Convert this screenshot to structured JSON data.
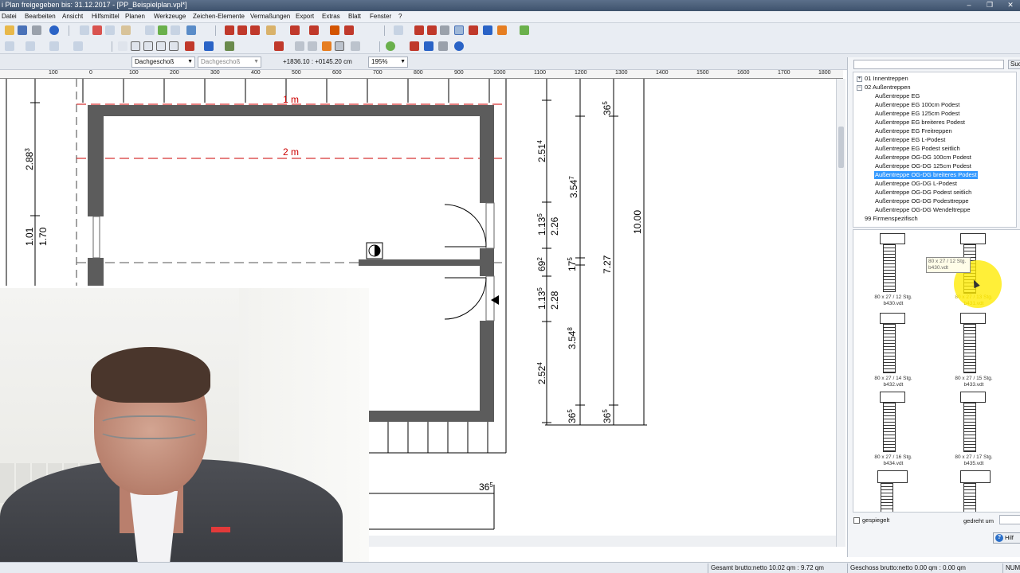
{
  "window": {
    "title": "i Plan freigegeben bis: 31.12.2017 - [PP_Beispielplan.vpl*]",
    "controls": [
      "–",
      "❐",
      "✕"
    ]
  },
  "menu": [
    "Datei",
    "Bearbeiten",
    "Ansicht",
    "Hilfsmittel",
    "Planen",
    "Werkzeuge",
    "Zeichen-Elemente",
    "Vermaßungen",
    "Export",
    "Extras",
    "Blatt",
    "Fenster",
    "?"
  ],
  "optionsbar": {
    "floor_select": "Dachgeschoß",
    "floor_select2": "Dachgeschoß",
    "coords": "+1836.10 : +0145.20 cm",
    "zoom": "195%"
  },
  "ruler": {
    "labels": [
      "100",
      "0",
      "100",
      "200",
      "300",
      "400",
      "500",
      "600",
      "700",
      "800",
      "900",
      "1000",
      "1100",
      "1200",
      "1300",
      "1400",
      "1500",
      "1600",
      "1700",
      "1800"
    ]
  },
  "drawing": {
    "dim_1m": "1 m",
    "dim_2m": "2 m",
    "dims_left": {
      "d288": "2.88",
      "d288_sup": "3",
      "d101": "1.01",
      "d170": "1.70"
    },
    "dims_right1": {
      "a": "2.51",
      "a_sup": "4",
      "b": "1.13",
      "b_sup": "5",
      "c": "69",
      "c_sup": "2",
      "d": "1.13",
      "d_sup": "5",
      "e": "2.52",
      "e_sup": "4"
    },
    "dims_right2": {
      "a": "3.54",
      "a_sup": "7",
      "b": "2.26",
      "c": "17",
      "c_sup": "5",
      "d": "2.28",
      "e": "3.54",
      "e_sup": "8",
      "f": "36",
      "f_sup": "5"
    },
    "dims_right3": {
      "a": "36",
      "a_sup": "5",
      "b": "7.27",
      "c": "36",
      "c_sup": "5"
    },
    "dims_right4": {
      "a": "10.00"
    },
    "dim_bottom": {
      "a": "36",
      "a_sup": "5"
    }
  },
  "library": {
    "search_button": "Such",
    "tree": [
      {
        "label": "01 Innentreppen",
        "level": 0,
        "expander": "+"
      },
      {
        "label": "02 Außentreppen",
        "level": 0,
        "expander": "−"
      },
      {
        "label": "Außentreppe EG",
        "level": 1
      },
      {
        "label": "Außentreppe EG 100cm Podest",
        "level": 1
      },
      {
        "label": "Außentreppe EG 125cm Podest",
        "level": 1
      },
      {
        "label": "Außentreppe EG breiteres Podest",
        "level": 1
      },
      {
        "label": "Außentreppe EG Freitreppen",
        "level": 1
      },
      {
        "label": "Außentreppe EG L-Podest",
        "level": 1
      },
      {
        "label": "Außentreppe EG Podest seitlich",
        "level": 1
      },
      {
        "label": "Außentreppe OG-DG 100cm Podest",
        "level": 1
      },
      {
        "label": "Außentreppe OG-DG 125cm Podest",
        "level": 1
      },
      {
        "label": "Außentreppe OG-DG breiteres Podest",
        "level": 1,
        "selected": true
      },
      {
        "label": "Außentreppe OG-DG L-Podest",
        "level": 1
      },
      {
        "label": "Außentreppe OG-DG Podest seitlich",
        "level": 1
      },
      {
        "label": "Außentreppe OG-DG Podesttreppe",
        "level": 1
      },
      {
        "label": "Außentreppe OG-DG Wendeltreppe",
        "level": 1
      },
      {
        "label": "99 Firmenspezifisch",
        "level": 0
      }
    ],
    "thumbnails": [
      {
        "caption": "80 x 27 / 12 Stg.",
        "file": "b430.vdt",
        "steps": 12
      },
      {
        "caption": "80 x 27 / 13 Stg.",
        "file": "b431.vdt",
        "steps": 13
      },
      {
        "caption": "80 x 27 / 14 Stg.",
        "file": "b432.vdt",
        "steps": 14
      },
      {
        "caption": "80 x 27 / 15 Stg.",
        "file": "b433.vdt",
        "steps": 15
      },
      {
        "caption": "80 x 27 / 16 Stg.",
        "file": "b434.vdt",
        "steps": 16
      },
      {
        "caption": "80 x 27 / 17 Stg.",
        "file": "b435.vdt",
        "steps": 17
      },
      {
        "caption": "",
        "file": "",
        "steps": 10
      },
      {
        "caption": "",
        "file": "",
        "steps": 10
      }
    ],
    "tooltip": {
      "line1": "80 x 27 / 12 Stg.",
      "line2": "b430.vdt"
    },
    "mirrored_label": "gespiegelt",
    "rotated_label": "gedreht um",
    "rotated_value": "0",
    "help_button": "Hilf"
  },
  "status": {
    "total": "Gesamt brutto:netto 10.02 qm : 9.72 qm",
    "floor": "Geschoss brutto:netto 0.00 qm : 0.00 qm",
    "num": "NUM"
  },
  "colors": {
    "accent": "#3399ff",
    "wall": "#5c5c5c",
    "dim_red": "#cc0000"
  }
}
